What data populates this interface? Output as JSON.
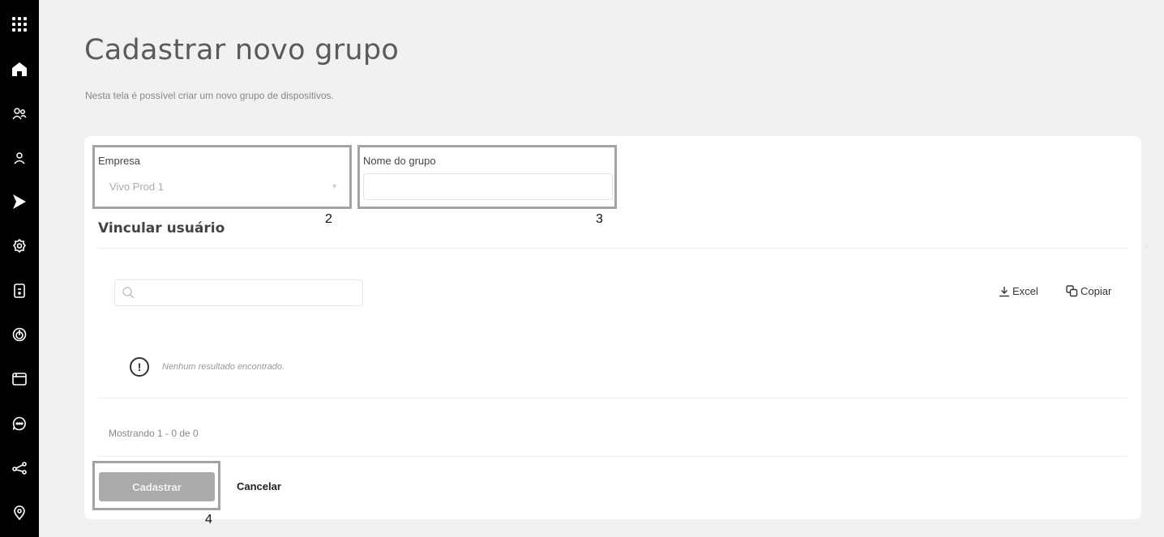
{
  "sidebar": {
    "icons": [
      "apps-grid-icon",
      "home-icon",
      "users-icon",
      "user-icon",
      "play-icon",
      "settings-icon",
      "device-icon",
      "target-icon",
      "window-icon",
      "chat-icon",
      "share-icon",
      "location-icon"
    ]
  },
  "header": {
    "title": "Cadastrar novo grupo",
    "subtitle": "Nesta tela é possível criar um novo grupo de dispositivos."
  },
  "form": {
    "company_label": "Empresa",
    "company_value": "Vivo Prod 1",
    "group_name_label": "Nome do grupo",
    "group_name_value": "",
    "group_name_placeholder": ""
  },
  "link_users": {
    "title": "Vincular usuário",
    "search_placeholder": "",
    "excel_label": "Excel",
    "copy_label": "Copiar",
    "empty_message": "Nenhum resultado encontrado.",
    "showing": "Mostrando 1 - 0 de 0"
  },
  "actions": {
    "submit_label": "Cadastrar",
    "cancel_label": "Cancelar"
  },
  "annotations": {
    "company": "2",
    "group_name": "3",
    "submit": "4"
  },
  "colors": {
    "sidebar_bg": "#000000",
    "page_bg": "#f1f1f1",
    "annotation_border": "#a3a3a3",
    "submit_disabled": "#aaaaaa"
  }
}
